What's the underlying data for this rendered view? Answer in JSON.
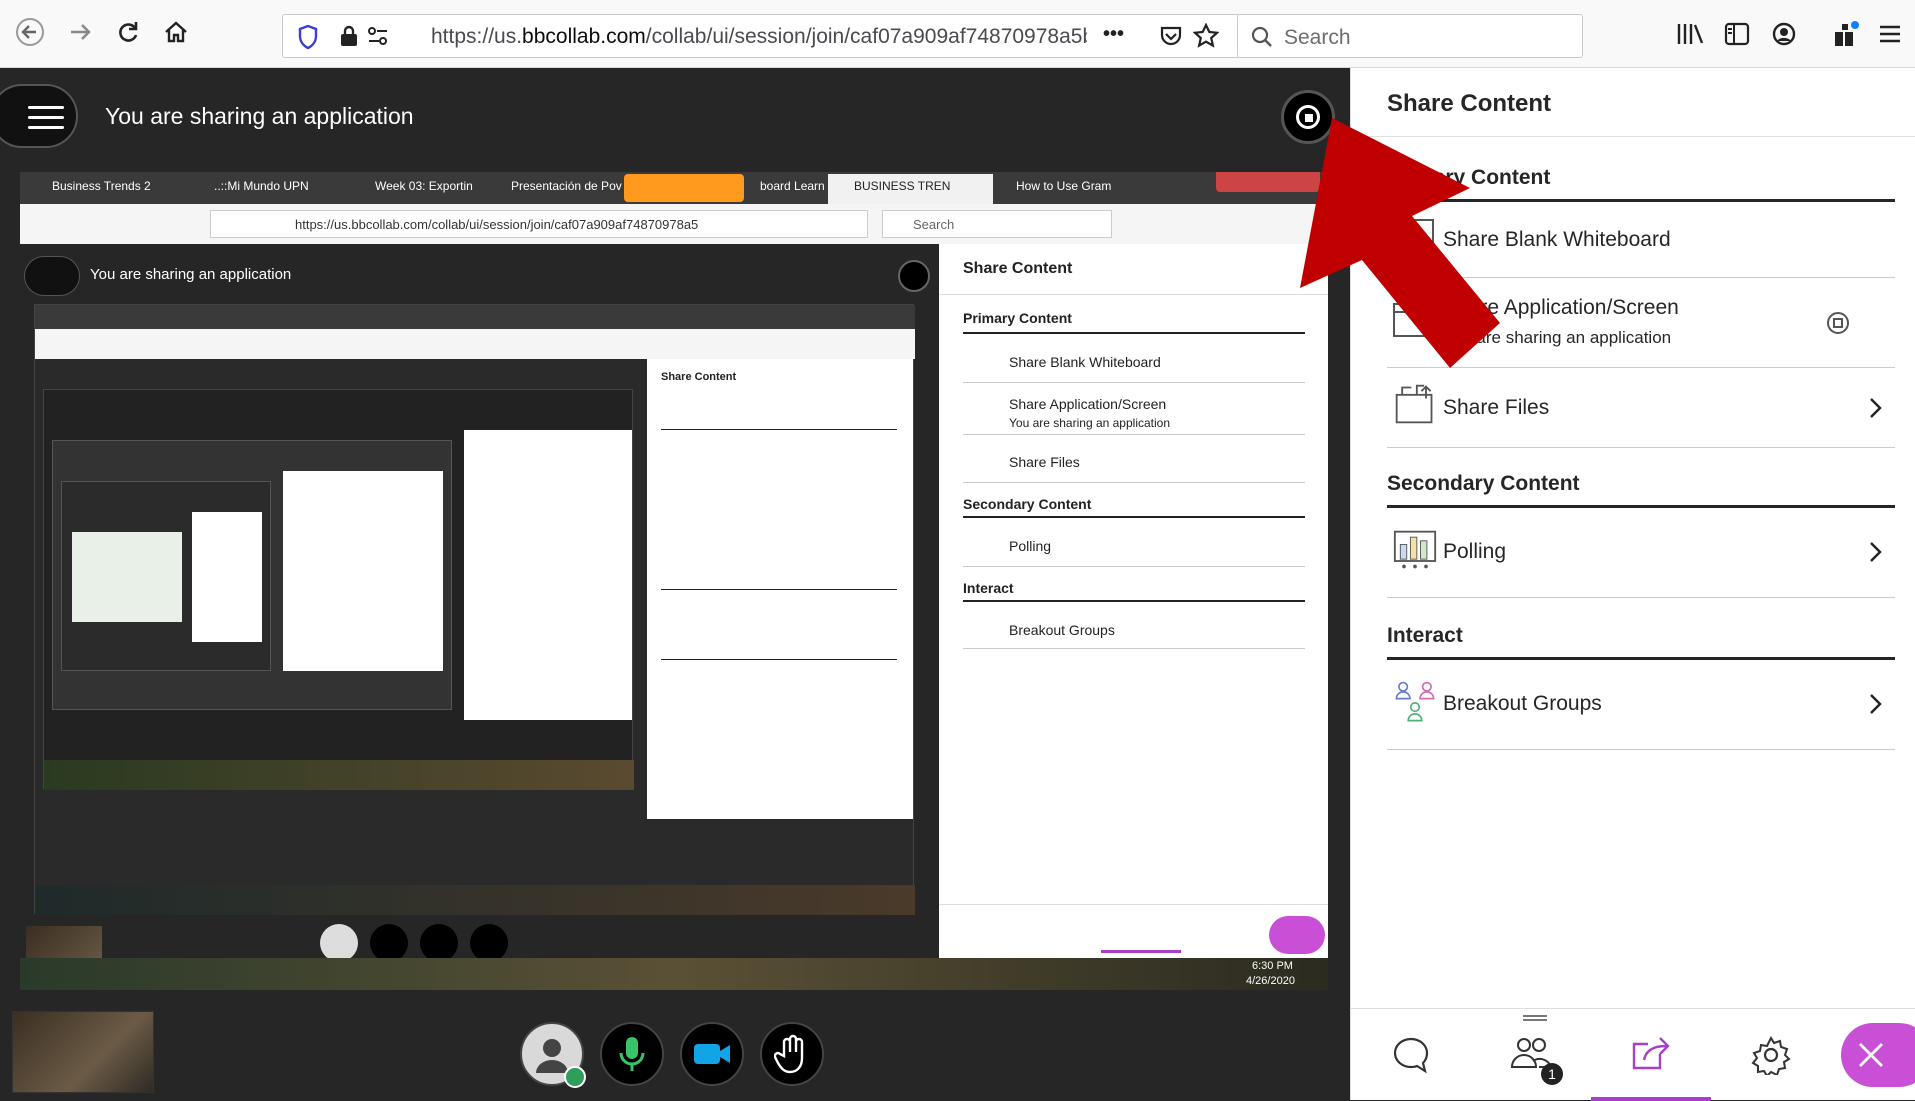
{
  "browser": {
    "url_prefix": "https://us.",
    "url_domain": "bbcollab.com",
    "url_rest": "/collab/ui/session/join/caf07a909af74870978a5b",
    "search_placeholder": "Search",
    "more_glyph": "•••"
  },
  "stage": {
    "sharing_text": "You are sharing an application"
  },
  "nested": {
    "tabs": [
      {
        "label": "Business Trends 2"
      },
      {
        "label": "..::Mi Mundo UPN"
      },
      {
        "label": "Week 03: Exportin"
      },
      {
        "label": "Presentación de Pov"
      },
      {
        "label": "board Learn"
      },
      {
        "label": "BUSINESS TREN"
      },
      {
        "label": "How to Use Gram"
      }
    ],
    "url": "https://us.bbcollab.com/collab/ui/session/join/caf07a909af74870978a5",
    "search_placeholder": "Search",
    "sharing_text": "You are sharing an application",
    "panel_title": "Share Content",
    "primary_heading": "Primary Content",
    "whiteboard_label": "Share Blank Whiteboard",
    "app_label": "Share Application/Screen",
    "app_sub": "You are sharing an application",
    "files_label": "Share Files",
    "secondary_heading": "Secondary Content",
    "polling_label": "Polling",
    "interact_heading": "Interact",
    "breakout_label": "Breakout Groups",
    "clock_time": "6:30 PM",
    "clock_date": "4/26/2020"
  },
  "panel": {
    "title": "Share Content",
    "primary_heading": "Primary Content",
    "primary_items": [
      {
        "label": "Share Blank Whiteboard",
        "icon": "whiteboard-icon"
      },
      {
        "label": "Share Application/Screen",
        "sub": "You are sharing an application",
        "icon": "screen-share-icon"
      },
      {
        "label": "Share Files",
        "icon": "files-icon"
      }
    ],
    "secondary_heading": "Secondary Content",
    "secondary_items": [
      {
        "label": "Polling",
        "icon": "polling-icon"
      }
    ],
    "interact_heading": "Interact",
    "interact_items": [
      {
        "label": "Breakout Groups",
        "icon": "breakout-groups-icon"
      }
    ],
    "attendee_badge": "1"
  },
  "colors": {
    "accent": "#a83fc7",
    "close_pill": "#c94fd6",
    "arrow": "#c00000"
  }
}
